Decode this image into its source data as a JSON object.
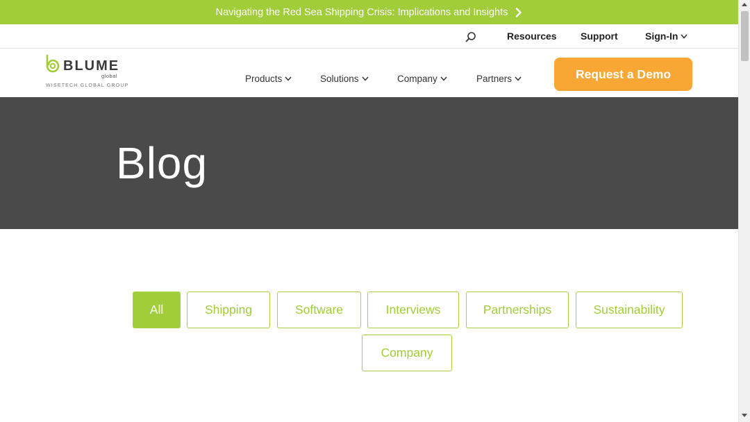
{
  "announcement": {
    "text": "Navigating the Red Sea Shipping Crisis: Implications and Insights",
    "color": "#a1cd3a"
  },
  "utility_nav": {
    "resources": "Resources",
    "support": "Support",
    "signin": "Sign-In"
  },
  "logo": {
    "word": "BLUME",
    "sub": "global",
    "group": "WISETECH GLOBAL GROUP"
  },
  "main_nav": {
    "items": [
      {
        "label": "Products"
      },
      {
        "label": "Solutions"
      },
      {
        "label": "Company"
      },
      {
        "label": "Partners"
      }
    ],
    "cta": "Request a Demo",
    "cta_color": "#f8a735"
  },
  "hero": {
    "title": "Blog",
    "background": "#4a4a4b"
  },
  "filters": {
    "selected": "All",
    "items": [
      {
        "label": "All"
      },
      {
        "label": "Shipping"
      },
      {
        "label": "Software"
      },
      {
        "label": "Interviews"
      },
      {
        "label": "Partnerships"
      },
      {
        "label": "Sustainability"
      },
      {
        "label": "Company"
      }
    ]
  },
  "icons": {
    "announcement_arrow": "chevron-right-icon",
    "search": "search-icon",
    "dropdown": "chevron-down-icon"
  }
}
